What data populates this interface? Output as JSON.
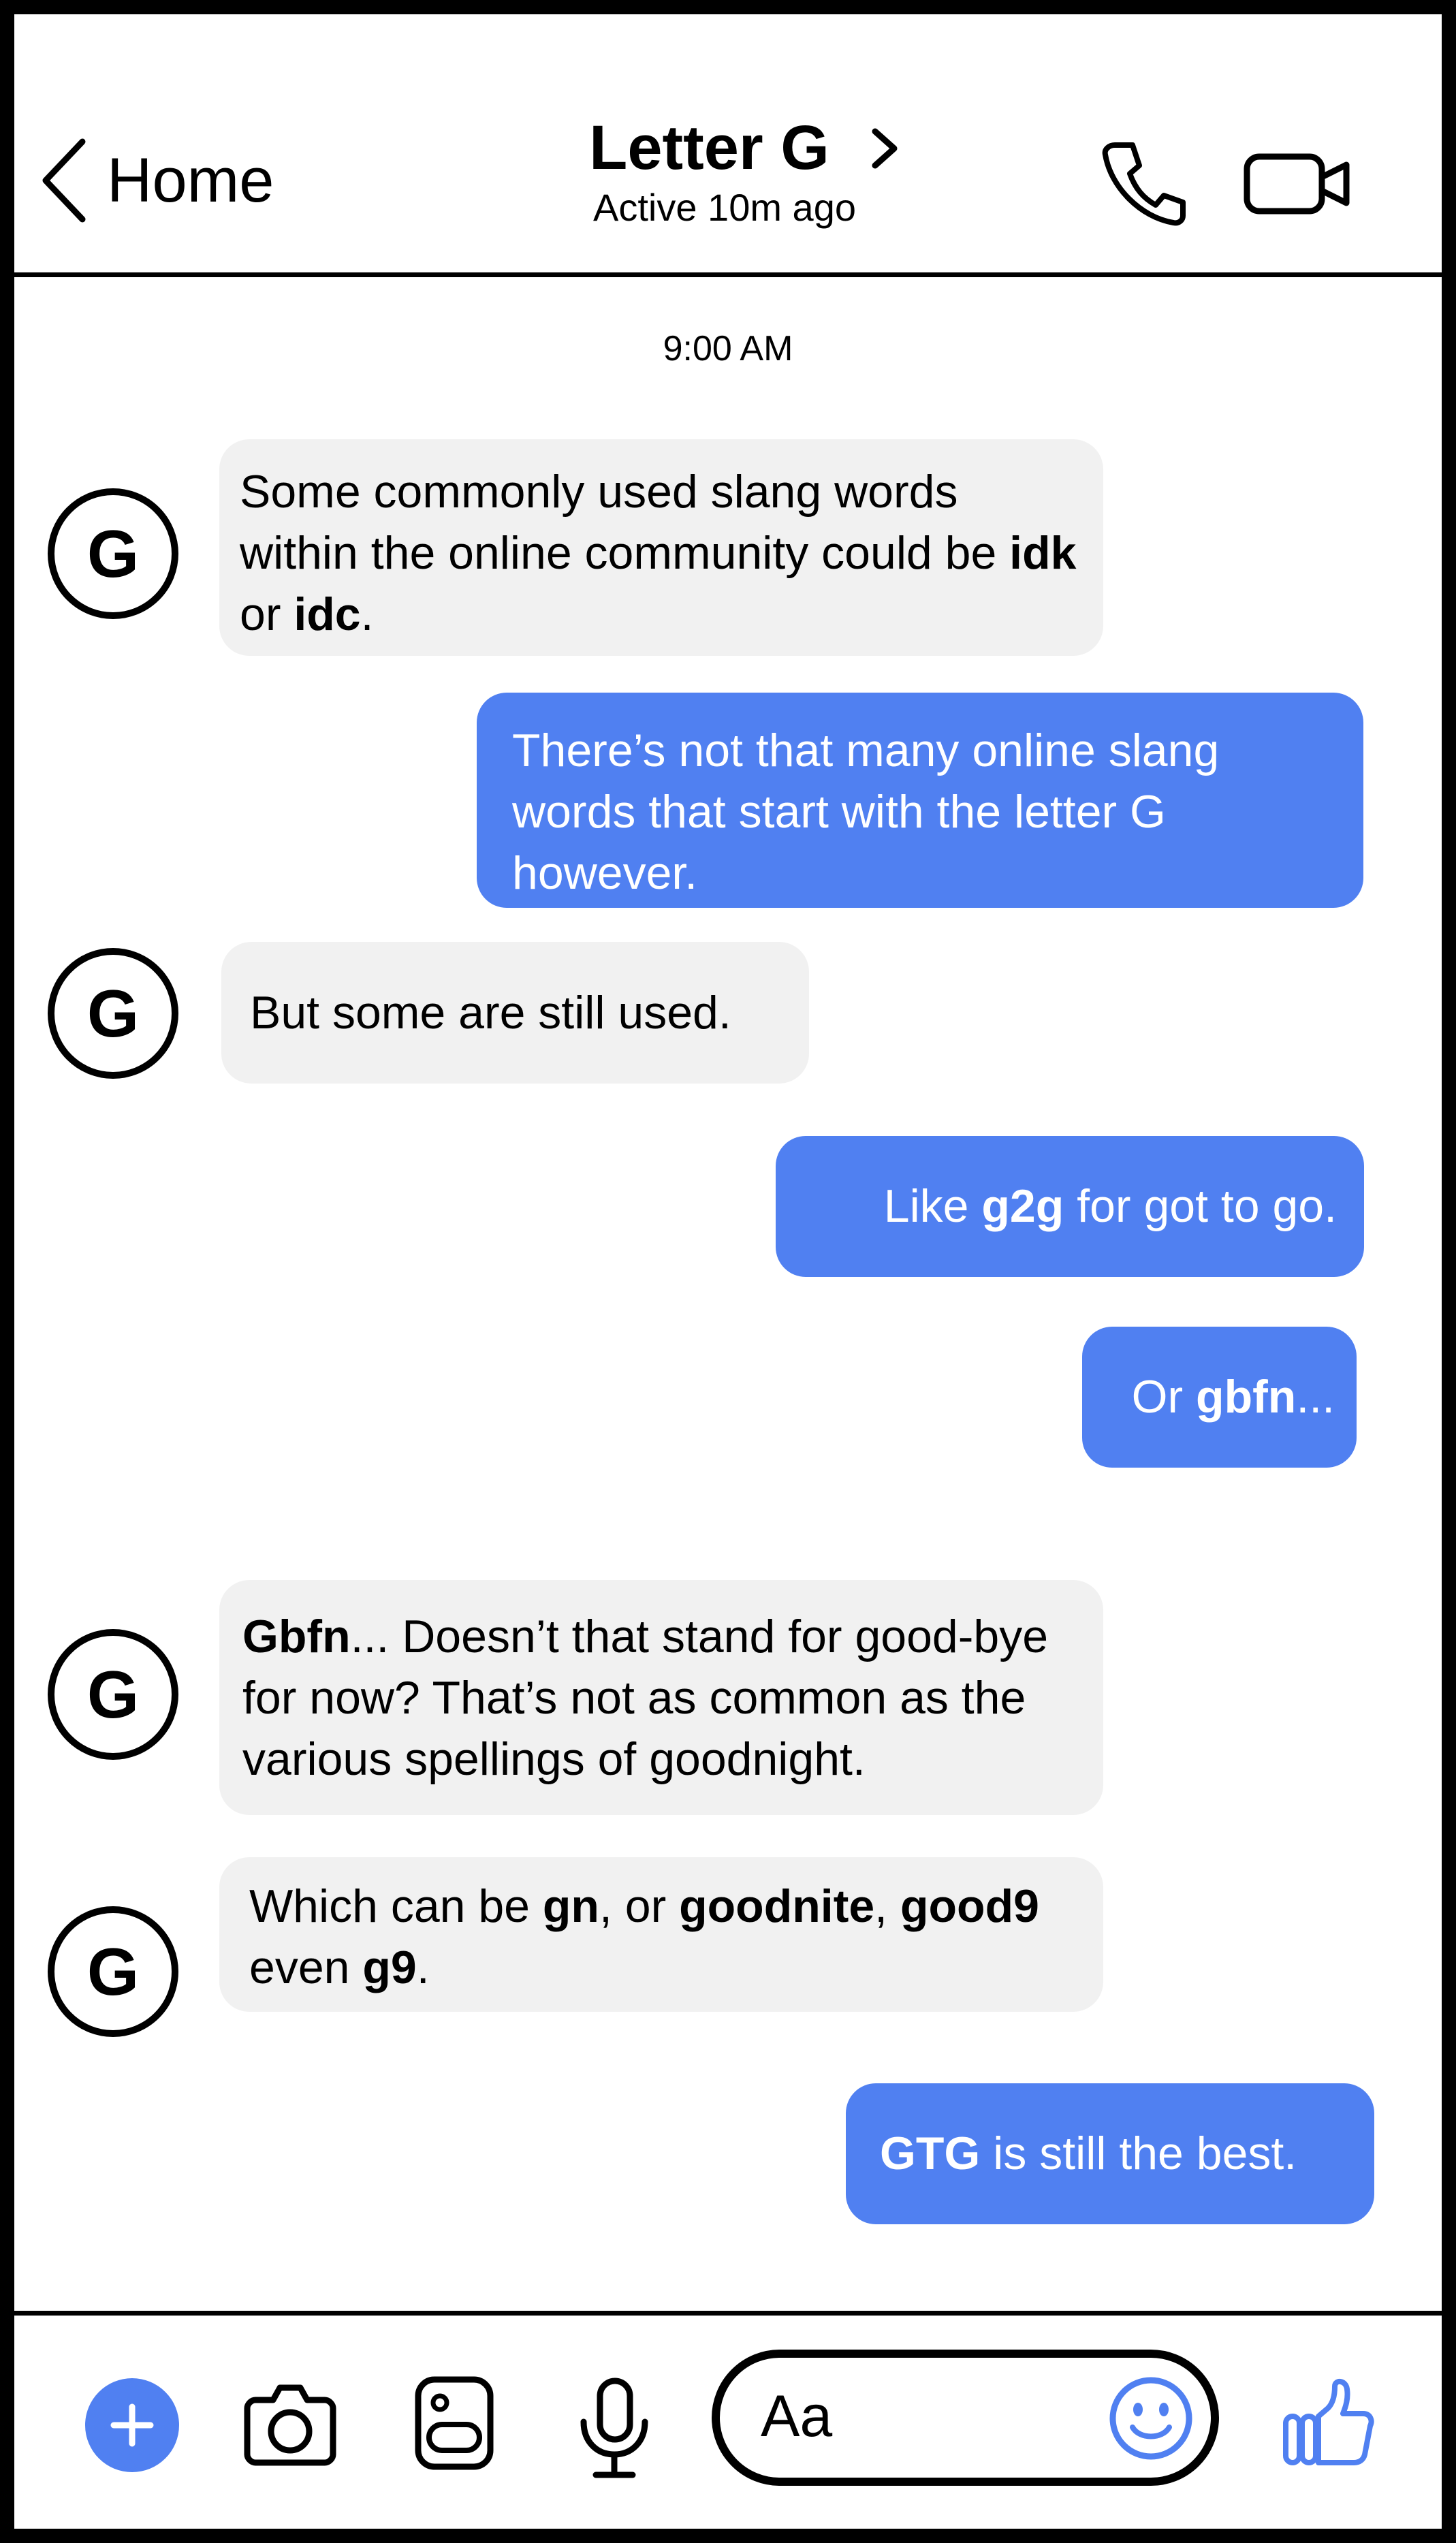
{
  "header": {
    "back_label": "Home",
    "contact_name": "Letter G",
    "status": "Active 10m ago"
  },
  "conversation": {
    "timestamp": "9:00 AM",
    "avatar_letter": "G",
    "messages": [
      {
        "from": "them",
        "segments": [
          {
            "text": "Some commonly used slang words within the online community could be ",
            "bold": false
          },
          {
            "text": "idk",
            "bold": true
          },
          {
            "text": " or ",
            "bold": false
          },
          {
            "text": "idc",
            "bold": true
          },
          {
            "text": ".",
            "bold": false
          }
        ]
      },
      {
        "from": "me",
        "segments": [
          {
            "text": "There’s not that many online slang words that start with the letter G however.",
            "bold": false
          }
        ]
      },
      {
        "from": "them",
        "segments": [
          {
            "text": "But some are still used.",
            "bold": false
          }
        ]
      },
      {
        "from": "me",
        "segments": [
          {
            "text": "Like ",
            "bold": false
          },
          {
            "text": "g2g",
            "bold": true
          },
          {
            "text": " for got to go.",
            "bold": false
          }
        ]
      },
      {
        "from": "me",
        "segments": [
          {
            "text": "Or ",
            "bold": false
          },
          {
            "text": "gbfn",
            "bold": true
          },
          {
            "text": "...",
            "bold": false
          }
        ]
      },
      {
        "from": "them",
        "segments": [
          {
            "text": "Gbfn",
            "bold": true
          },
          {
            "text": "... Doesn’t that stand for good-bye for now? That’s not as common as the various spellings of goodnight.",
            "bold": false
          }
        ]
      },
      {
        "from": "them",
        "segments": [
          {
            "text": "Which can be ",
            "bold": false
          },
          {
            "text": "gn",
            "bold": true
          },
          {
            "text": ", or ",
            "bold": false
          },
          {
            "text": "goodnite",
            "bold": true
          },
          {
            "text": ", ",
            "bold": false
          },
          {
            "text": "good9",
            "bold": true
          },
          {
            "text": " even ",
            "bold": false
          },
          {
            "text": "g9",
            "bold": true
          },
          {
            "text": ".",
            "bold": false
          }
        ]
      },
      {
        "from": "me",
        "segments": [
          {
            "text": "GTG",
            "bold": true
          },
          {
            "text": " is still the best.",
            "bold": false
          }
        ]
      }
    ]
  },
  "composer": {
    "placeholder": "Aa"
  },
  "icons": {
    "back": "chevron-left-icon",
    "info": "chevron-right-icon",
    "call": "phone-icon",
    "video": "video-camera-icon",
    "plus": "plus-icon",
    "camera": "camera-icon",
    "gallery": "gallery-icon",
    "mic": "microphone-icon",
    "emoji": "smiley-icon",
    "like": "thumbs-up-icon"
  },
  "colors": {
    "accent": "#5080f1",
    "incoming_bubble": "#f1f1f1",
    "outline": "#000000"
  }
}
